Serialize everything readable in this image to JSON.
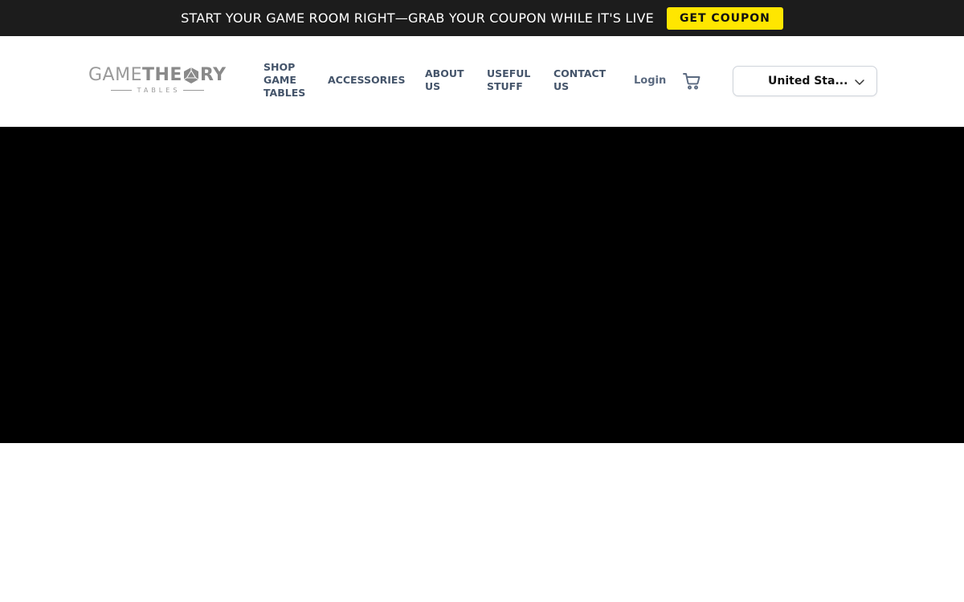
{
  "announcement": {
    "text": "START YOUR GAME ROOM RIGHT—GRAB YOUR COUPON WHILE IT'S LIVE",
    "button_label": "GET COUPON",
    "background_color": "#1c1c1c",
    "button_color": "#ffe600"
  },
  "logo": {
    "word_light": "GAME",
    "word_bold_a": "THE",
    "word_bold_b": "RY",
    "subtitle": "TABLES"
  },
  "nav": {
    "shop": [
      "SHOP",
      "GAME",
      "TABLES"
    ],
    "accessories": [
      "ACCESSORIES"
    ],
    "about": [
      "ABOUT",
      "US"
    ],
    "useful": [
      "USEFUL",
      "STUFF"
    ],
    "contact": [
      "CONTACT",
      "US"
    ],
    "text_color": "#44546a"
  },
  "account": {
    "login_label": "Login",
    "cart_icon": "cart-icon"
  },
  "country_selector": {
    "selected": "United Sta...",
    "chevron_icon": "chevron-down-icon"
  },
  "hero": {
    "background_color": "#000000"
  }
}
